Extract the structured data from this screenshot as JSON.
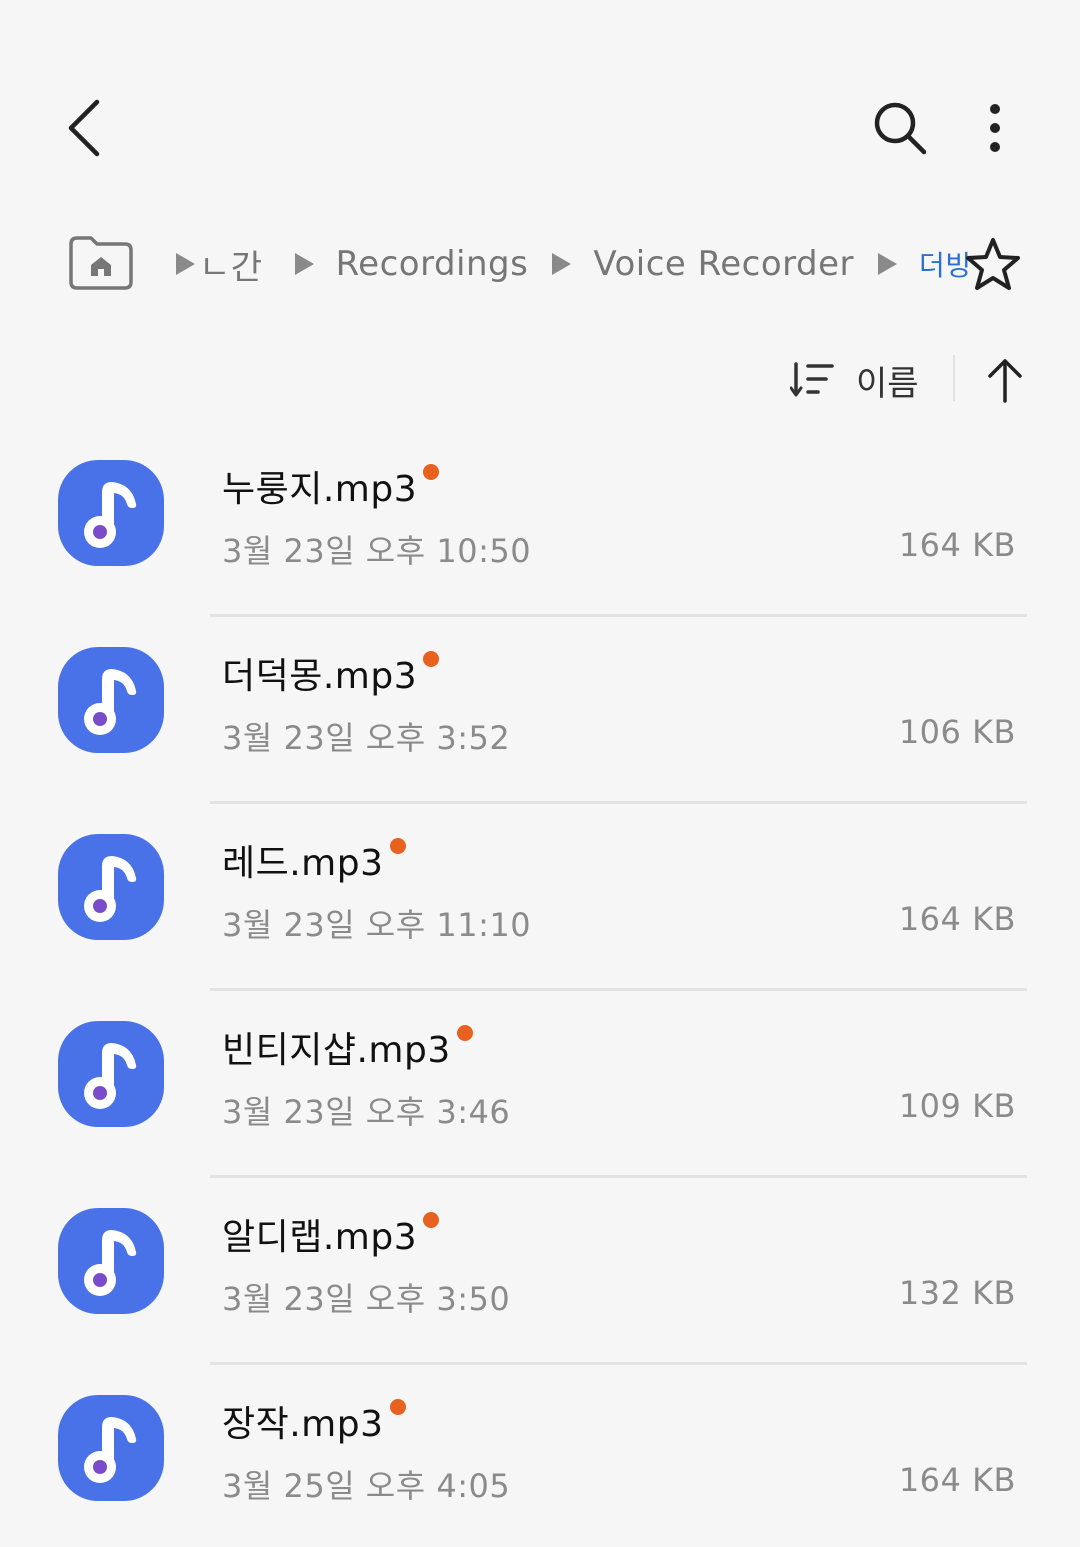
{
  "header": {
    "back_icon": "chevron-left-icon",
    "search_icon": "search-icon",
    "more_icon": "more-vertical-icon"
  },
  "breadcrumb": {
    "home_icon": "home-folder-icon",
    "items": [
      {
        "label": "내장 저장공간"
      },
      {
        "label": "Recordings"
      },
      {
        "label": "Voice Recorder"
      },
      {
        "label": "더빙"
      }
    ],
    "internal_label": "ㄴ간",
    "favorite_icon": "star-outline-icon"
  },
  "sort": {
    "label": "이름",
    "sort_icon": "sort-list-icon",
    "order_icon": "arrow-up-icon"
  },
  "files": [
    {
      "name": "누룽지.mp3",
      "date": "3월 23일 오후 10:50",
      "size": "164 KB",
      "is_new": true
    },
    {
      "name": "더덕몽.mp3",
      "date": "3월 23일 오후 3:52",
      "size": "106 KB",
      "is_new": true
    },
    {
      "name": "레드.mp3",
      "date": "3월 23일 오후 11:10",
      "size": "164 KB",
      "is_new": true
    },
    {
      "name": "빈티지샵.mp3",
      "date": "3월 23일 오후 3:46",
      "size": "109 KB",
      "is_new": true
    },
    {
      "name": "알디랩.mp3",
      "date": "3월 23일 오후 3:50",
      "size": "132 KB",
      "is_new": true
    },
    {
      "name": "장작.mp3",
      "date": "3월 25일 오후 4:05",
      "size": "164 KB",
      "is_new": true
    }
  ],
  "colors": {
    "accent": "#2a6fd6",
    "icon_blue": "#4a72e8",
    "new_dot": "#e8611f",
    "music_dot": "#7a4cc9"
  }
}
